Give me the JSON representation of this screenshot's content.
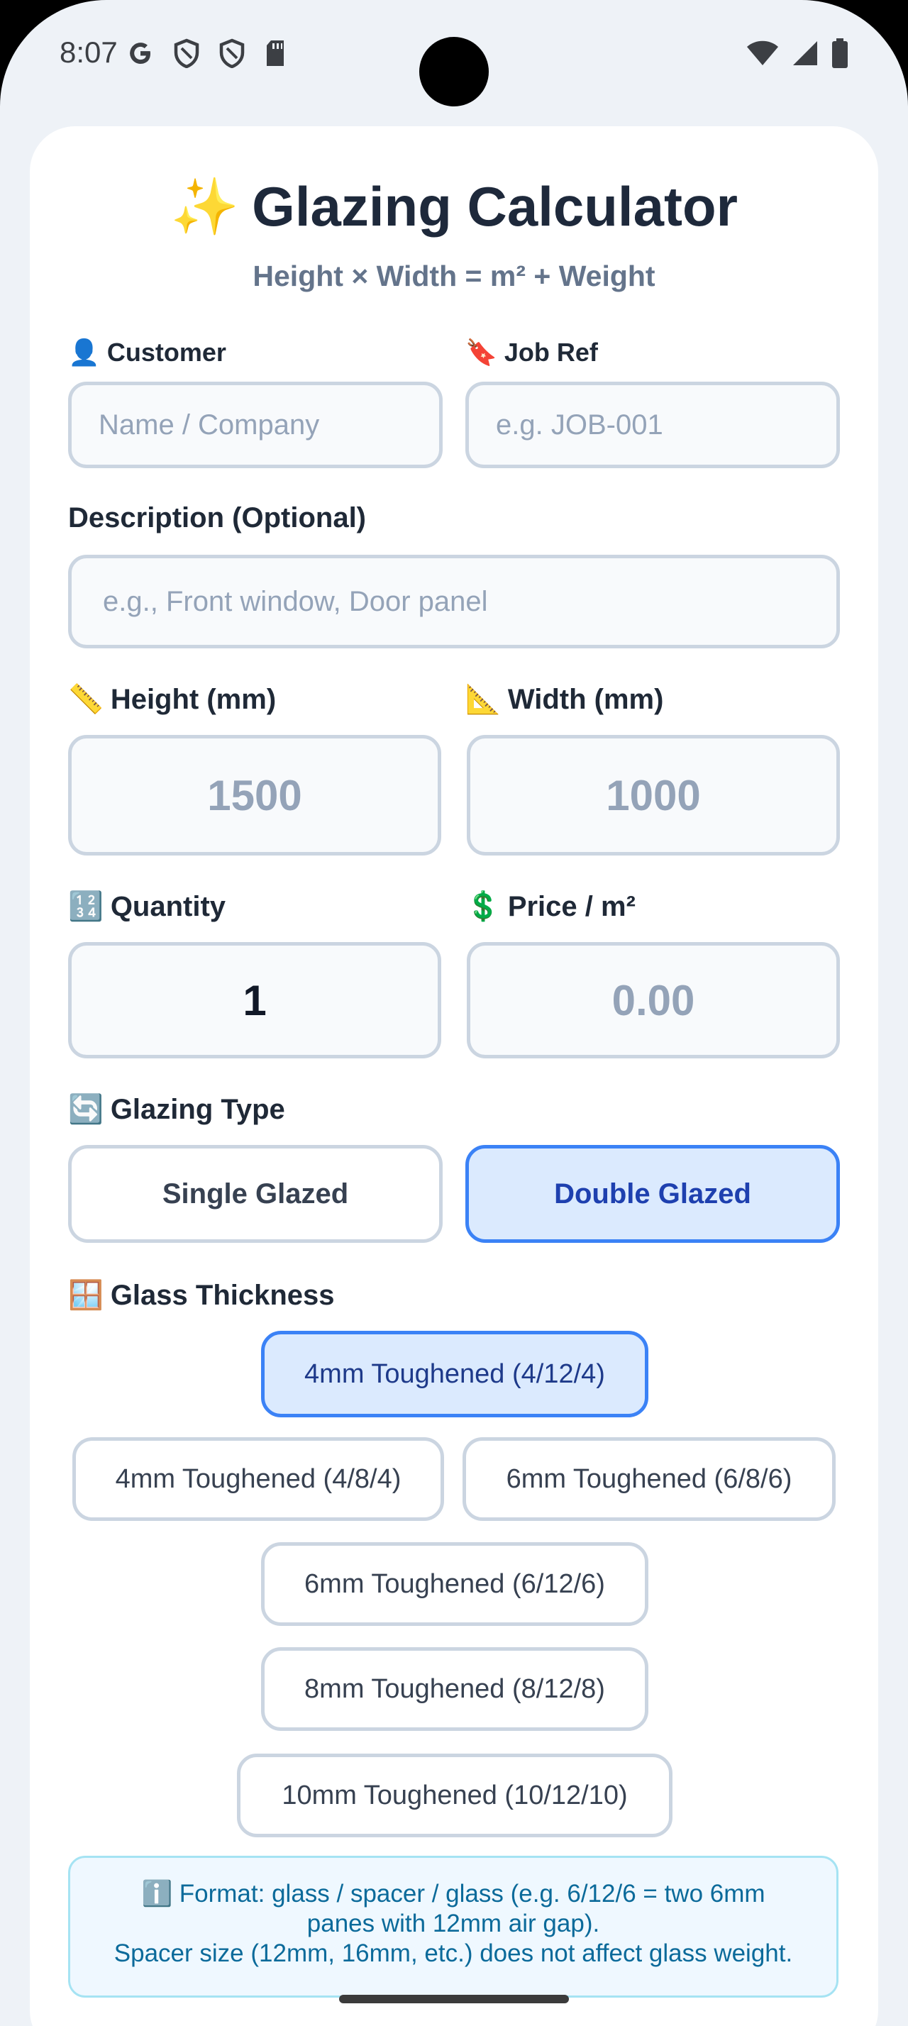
{
  "status_bar": {
    "time": "8:07",
    "left_icons": [
      "google-icon",
      "shield-icon",
      "shield-icon",
      "sd-card-icon"
    ],
    "right_icons": [
      "wifi-icon",
      "signal-icon",
      "battery-icon"
    ]
  },
  "header": {
    "emoji": "✨",
    "title": "Glazing Calculator",
    "subtitle": "Height × Width = m² + Weight"
  },
  "customer": {
    "emoji": "👤",
    "label": "Customer",
    "placeholder": "Name / Company"
  },
  "job_ref": {
    "emoji": "🔖",
    "label": "Job Ref",
    "placeholder": "e.g. JOB-001"
  },
  "description": {
    "label": "Description (Optional)",
    "placeholder": "e.g., Front window, Door panel"
  },
  "height": {
    "emoji": "📏",
    "label": "Height (mm)",
    "placeholder": "1500"
  },
  "width": {
    "emoji": "📐",
    "label": "Width (mm)",
    "placeholder": "1000"
  },
  "quantity": {
    "emoji": "🔢",
    "label": "Quantity",
    "value": "1"
  },
  "price": {
    "emoji": "💲",
    "label": "Price / m²",
    "placeholder": "0.00"
  },
  "glazing_type": {
    "emoji": "🔄",
    "label": "Glazing Type",
    "options": [
      "Single Glazed",
      "Double Glazed"
    ],
    "selected": "Double Glazed"
  },
  "glass_thickness": {
    "emoji": "🪟",
    "label": "Glass Thickness",
    "options": [
      "4mm Toughened (4/12/4)",
      "4mm Toughened (4/8/4)",
      "6mm Toughened (6/8/6)",
      "6mm Toughened (6/12/6)",
      "8mm Toughened (8/12/8)",
      "10mm Toughened (10/12/10)"
    ],
    "selected": "4mm Toughened (4/12/4)"
  },
  "info": {
    "emoji": "ℹ️",
    "line1": "Format: glass / spacer / glass (e.g. 6/12/6 = two 6mm",
    "line2": "panes with 12mm air gap).",
    "line3": "Spacer size (12mm, 16mm, etc.) does not affect glass weight."
  },
  "colors": {
    "accent": "#3b82f6",
    "selected_bg": "#dbeafe",
    "info_text": "#0b6a9a",
    "title": "#1e293b"
  }
}
